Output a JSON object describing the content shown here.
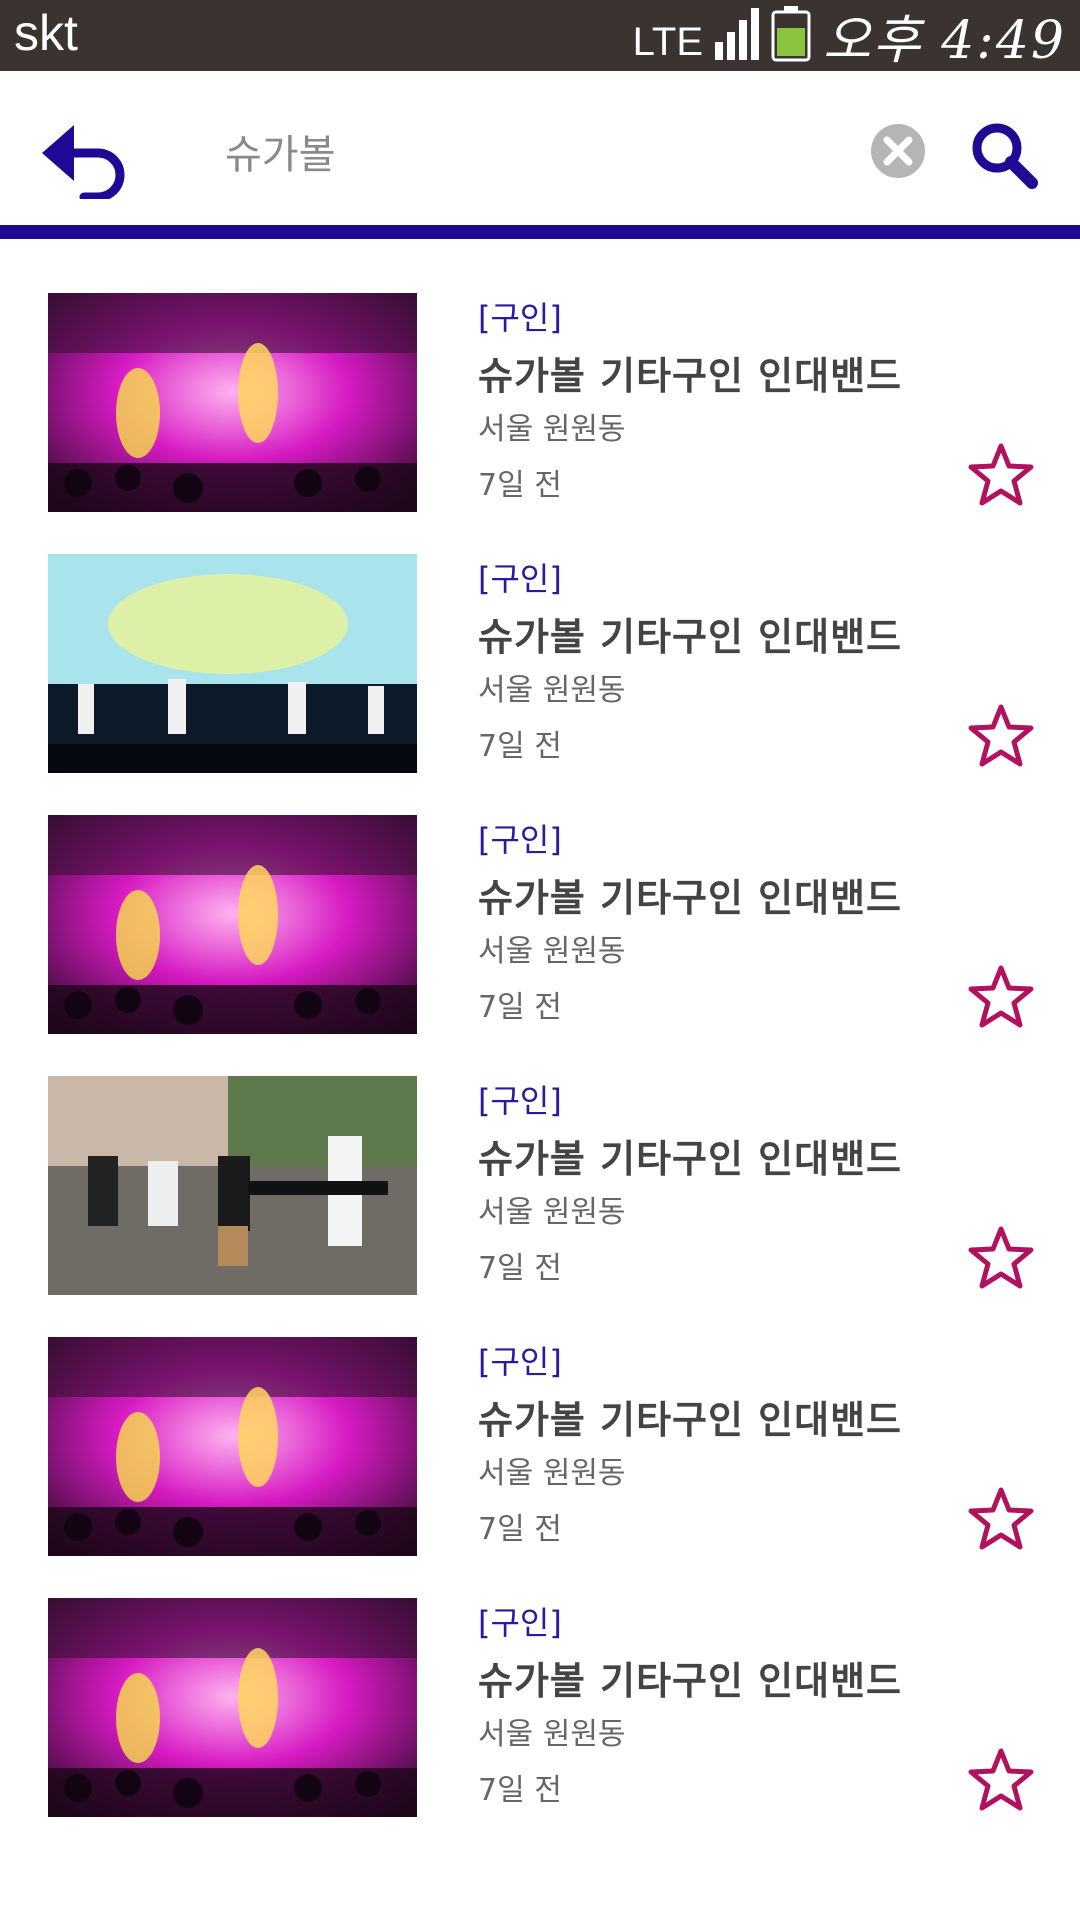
{
  "status_bar": {
    "carrier": "skt",
    "network": "LTE",
    "time": "오후 4:49"
  },
  "search": {
    "query": "슈가볼"
  },
  "colors": {
    "accent": "#1f0a96",
    "star": "#b0125e",
    "status_bar_bg": "#3a3330",
    "battery": "#8ac43f"
  },
  "results": [
    {
      "thumbnail": "concert-stage-pink",
      "tag": "[구인]",
      "title": "슈가볼 기타구인 인대밴드",
      "location": "서울 원원동",
      "date": "7일 전"
    },
    {
      "thumbnail": "concert-stage-white",
      "tag": "[구인]",
      "title": "슈가볼 기타구인 인대밴드",
      "location": "서울 원원동",
      "date": "7일 전"
    },
    {
      "thumbnail": "concert-stage-pink",
      "tag": "[구인]",
      "title": "슈가볼 기타구인 인대밴드",
      "location": "서울 원원동",
      "date": "7일 전"
    },
    {
      "thumbnail": "street-busking",
      "tag": "[구인]",
      "title": "슈가볼 기타구인 인대밴드",
      "location": "서울 원원동",
      "date": "7일 전"
    },
    {
      "thumbnail": "concert-stage-pink",
      "tag": "[구인]",
      "title": "슈가볼 기타구인 인대밴드",
      "location": "서울 원원동",
      "date": "7일 전"
    },
    {
      "thumbnail": "concert-stage-pink",
      "tag": "[구인]",
      "title": "슈가볼 기타구인 인대밴드",
      "location": "서울 원원동",
      "date": "7일 전"
    }
  ]
}
